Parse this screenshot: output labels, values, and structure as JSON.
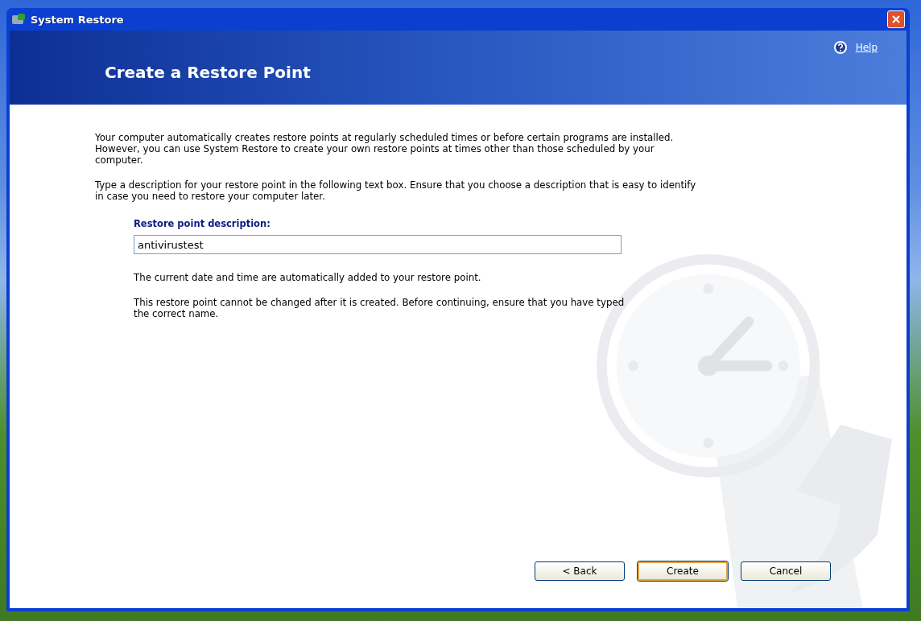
{
  "window": {
    "title": "System Restore"
  },
  "header": {
    "title": "Create a Restore Point",
    "help_link": "Help"
  },
  "intro": [
    "Your computer automatically creates restore points at regularly scheduled times or before certain programs are installed. However, you can use System Restore to create your own restore points at times other than those scheduled by your computer.",
    "Type a description for your restore point in the following text box. Ensure that you choose a description that is easy to identify in case you need to restore your computer later."
  ],
  "description_field": {
    "label": "Restore point description:",
    "value": "antivirustest"
  },
  "notes": [
    "The current date and time are automatically added to your restore point.",
    "This restore point cannot be changed after it is created. Before continuing, ensure that you have typed the correct name."
  ],
  "buttons": [
    {
      "label": "< Back",
      "default": false
    },
    {
      "label": "Create",
      "default": true
    },
    {
      "label": "Cancel",
      "default": false
    }
  ]
}
